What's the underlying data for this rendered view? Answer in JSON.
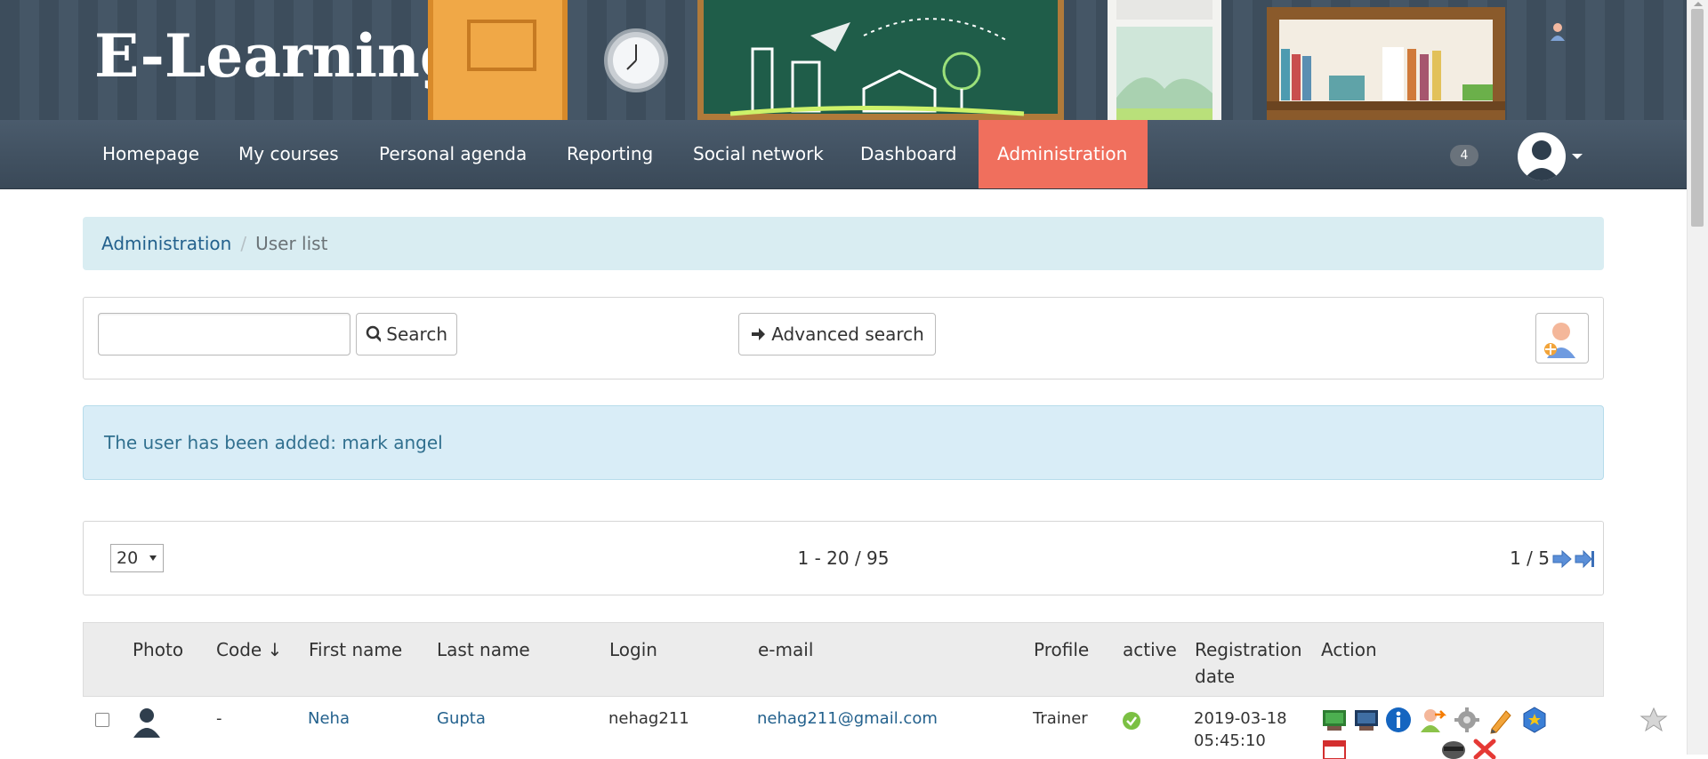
{
  "brand": {
    "logo_text": "E-Learning"
  },
  "nav": {
    "items": [
      {
        "label": "Homepage"
      },
      {
        "label": "My courses"
      },
      {
        "label": "Personal agenda"
      },
      {
        "label": "Reporting"
      },
      {
        "label": "Social network"
      },
      {
        "label": "Dashboard"
      },
      {
        "label": "Administration",
        "active": true
      }
    ],
    "notification_count": "4",
    "active_color": "#f06f5d"
  },
  "breadcrumb": {
    "root": "Administration",
    "current": "User list"
  },
  "search": {
    "input_value": "",
    "search_label": "Search",
    "advanced_label": "Advanced search",
    "add_user_icon": "add-user-icon"
  },
  "alert": {
    "message": "The user has been added: mark angel"
  },
  "pagination": {
    "per_page": "20",
    "range": "1 - 20 / 95",
    "page": "1 / 5"
  },
  "table": {
    "headers": {
      "photo": "Photo",
      "code": "Code ↓",
      "first_name": "First name",
      "last_name": "Last name",
      "login": "Login",
      "email": "e-mail",
      "profile": "Profile",
      "active": "active",
      "registration_1": "Registration",
      "registration_2": "date",
      "action": "Action"
    },
    "rows": [
      {
        "code": "-",
        "first_name": "Neha",
        "last_name": "Gupta",
        "login": "nehag211",
        "email": "nehag211@gmail.com",
        "profile": "Trainer",
        "active": "check-icon",
        "date_1": "2019-03-18",
        "date_2": "05:45:10"
      }
    ],
    "action_icons": [
      "course-icon",
      "session-icon",
      "info-icon",
      "login-as-icon",
      "reports-icon",
      "edit-icon",
      "badge-icon",
      "star-icon",
      "calendar-icon",
      "anonymize-icon",
      "delete-icon"
    ]
  }
}
